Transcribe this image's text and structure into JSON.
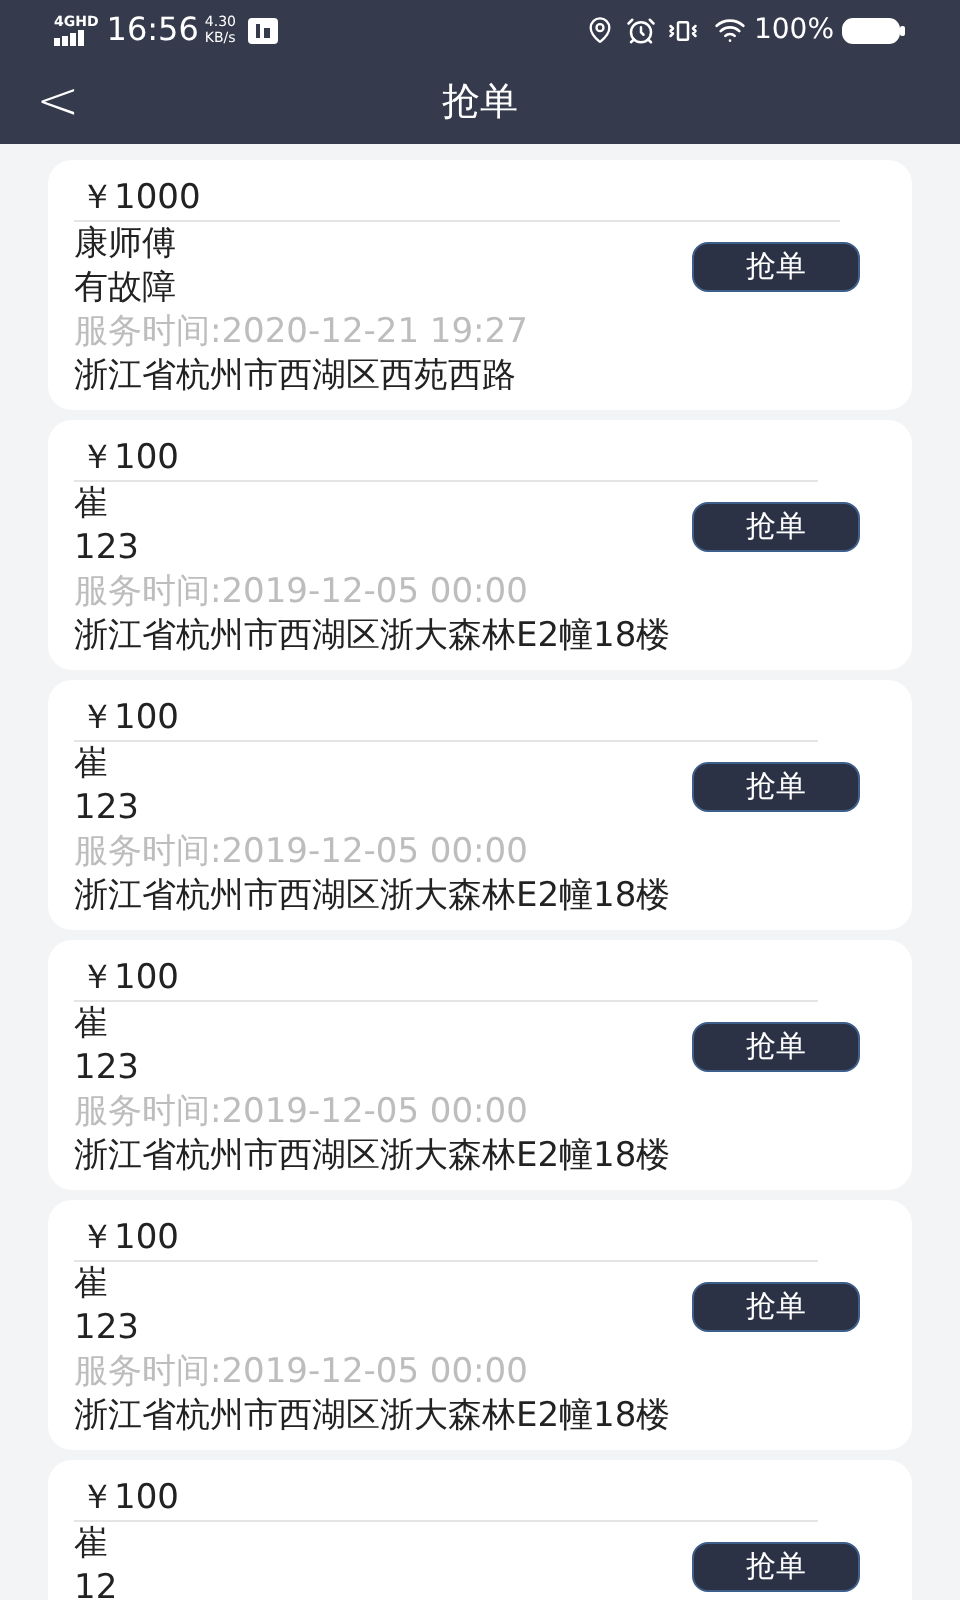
{
  "status_bar": {
    "network": "4G",
    "network_sub": "HD",
    "time": "16:56",
    "speed": "4.30",
    "speed_unit": "KB/s",
    "battery": "100%"
  },
  "header": {
    "back": "<",
    "title": "抢单"
  },
  "orders": [
    {
      "price": "￥1000",
      "name": "康师傅",
      "note": "有故障",
      "service_time": "服务时间:2020-12-21 19:27",
      "address": "浙江省杭州市西湖区西苑西路",
      "button": "抢单"
    },
    {
      "price": "￥100",
      "name": "崔",
      "note": "123",
      "service_time": "服务时间:2019-12-05 00:00",
      "address": "浙江省杭州市西湖区浙大森林E2幢18楼",
      "button": "抢单"
    },
    {
      "price": "￥100",
      "name": "崔",
      "note": "123",
      "service_time": "服务时间:2019-12-05 00:00",
      "address": "浙江省杭州市西湖区浙大森林E2幢18楼",
      "button": "抢单"
    },
    {
      "price": "￥100",
      "name": "崔",
      "note": "123",
      "service_time": "服务时间:2019-12-05 00:00",
      "address": "浙江省杭州市西湖区浙大森林E2幢18楼",
      "button": "抢单"
    },
    {
      "price": "￥100",
      "name": "崔",
      "note": "123",
      "service_time": "服务时间:2019-12-05 00:00",
      "address": "浙江省杭州市西湖区浙大森林E2幢18楼",
      "button": "抢单"
    },
    {
      "price": "￥100",
      "name": "崔",
      "note": "12",
      "button": "抢单"
    }
  ]
}
